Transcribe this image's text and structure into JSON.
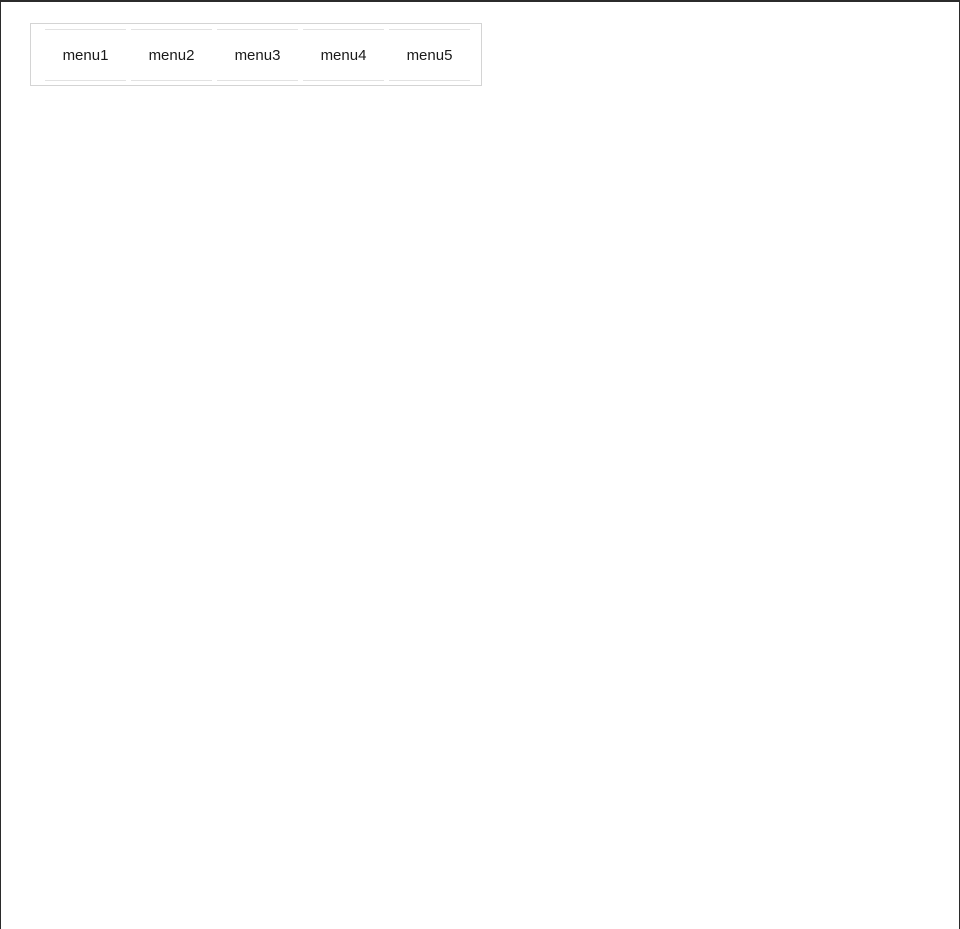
{
  "menu": {
    "items": [
      {
        "label": "menu1"
      },
      {
        "label": "menu2"
      },
      {
        "label": "menu3"
      },
      {
        "label": "menu4"
      },
      {
        "label": "menu5"
      }
    ]
  }
}
